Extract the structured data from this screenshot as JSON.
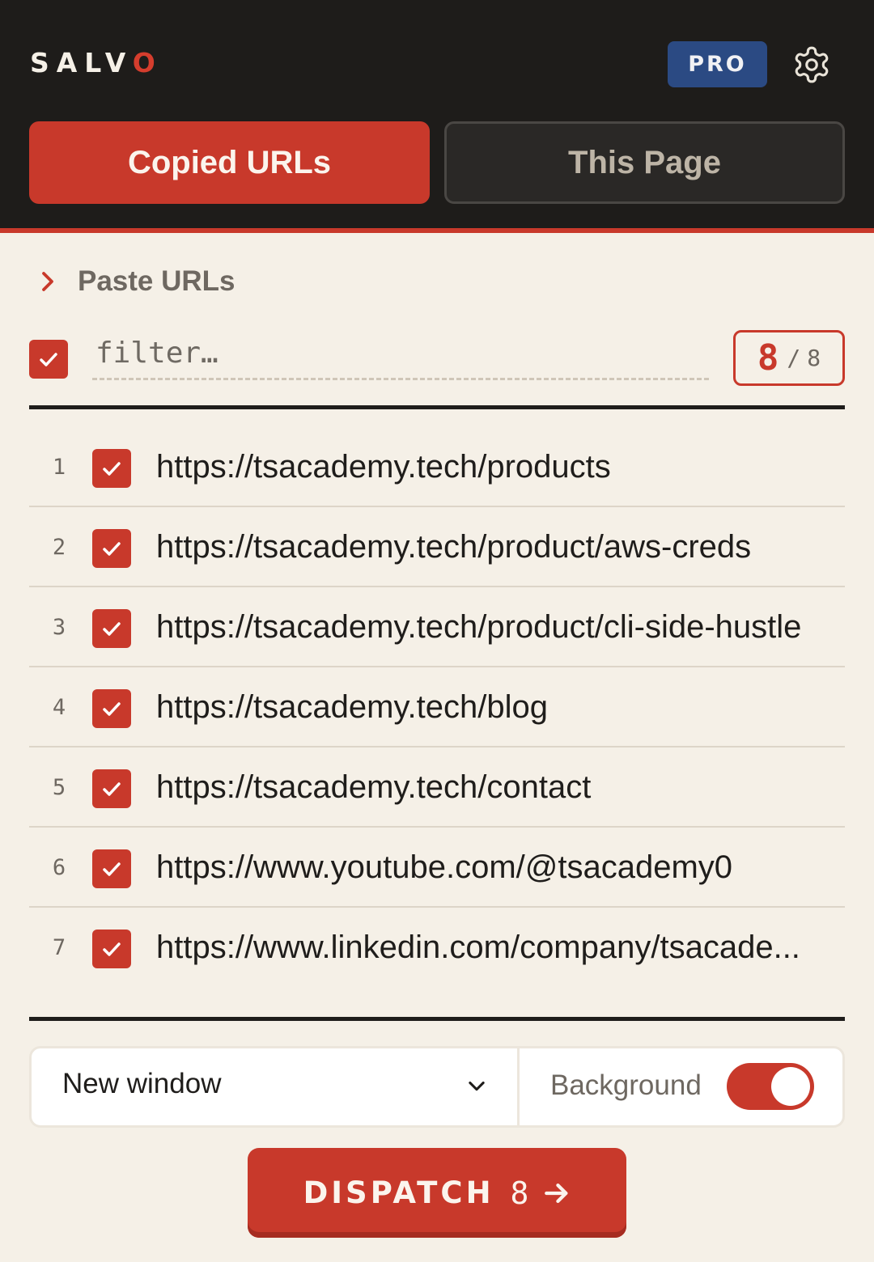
{
  "app": {
    "logo_main": "SALV",
    "logo_last": "O",
    "pro_badge": "PRO"
  },
  "tabs": [
    {
      "label": "Copied URLs",
      "active": true
    },
    {
      "label": "This Page",
      "active": false
    }
  ],
  "paste": {
    "label": "Paste URLs"
  },
  "filter": {
    "placeholder": "filter…",
    "value": "",
    "all_checked": true
  },
  "counter": {
    "selected": "8",
    "separator": "/",
    "total": "8"
  },
  "urls": [
    {
      "index": "1",
      "checked": true,
      "url": "https://tsacademy.tech/products"
    },
    {
      "index": "2",
      "checked": true,
      "url": "https://tsacademy.tech/product/aws-creds"
    },
    {
      "index": "3",
      "checked": true,
      "url": "https://tsacademy.tech/product/cli-side-hustle"
    },
    {
      "index": "4",
      "checked": true,
      "url": "https://tsacademy.tech/blog"
    },
    {
      "index": "5",
      "checked": true,
      "url": "https://tsacademy.tech/contact"
    },
    {
      "index": "6",
      "checked": true,
      "url": "https://www.youtube.com/@tsacademy0"
    },
    {
      "index": "7",
      "checked": true,
      "url": "https://www.linkedin.com/company/tsacade..."
    }
  ],
  "controls": {
    "open_mode": "New window",
    "background_label": "Background",
    "background_on": true
  },
  "dispatch": {
    "label": "DISPATCH",
    "count": "8"
  },
  "colors": {
    "accent": "#c8392b",
    "header_bg": "#1e1c1a",
    "page_bg": "#f5f0e7",
    "pro_bg": "#2b4a83"
  },
  "icons": {
    "settings": "gear-icon",
    "paste_toggle": "chevron-right-icon",
    "select": "chevron-down-icon",
    "dispatch": "arrow-right-icon",
    "checkbox": "checkmark-icon"
  }
}
